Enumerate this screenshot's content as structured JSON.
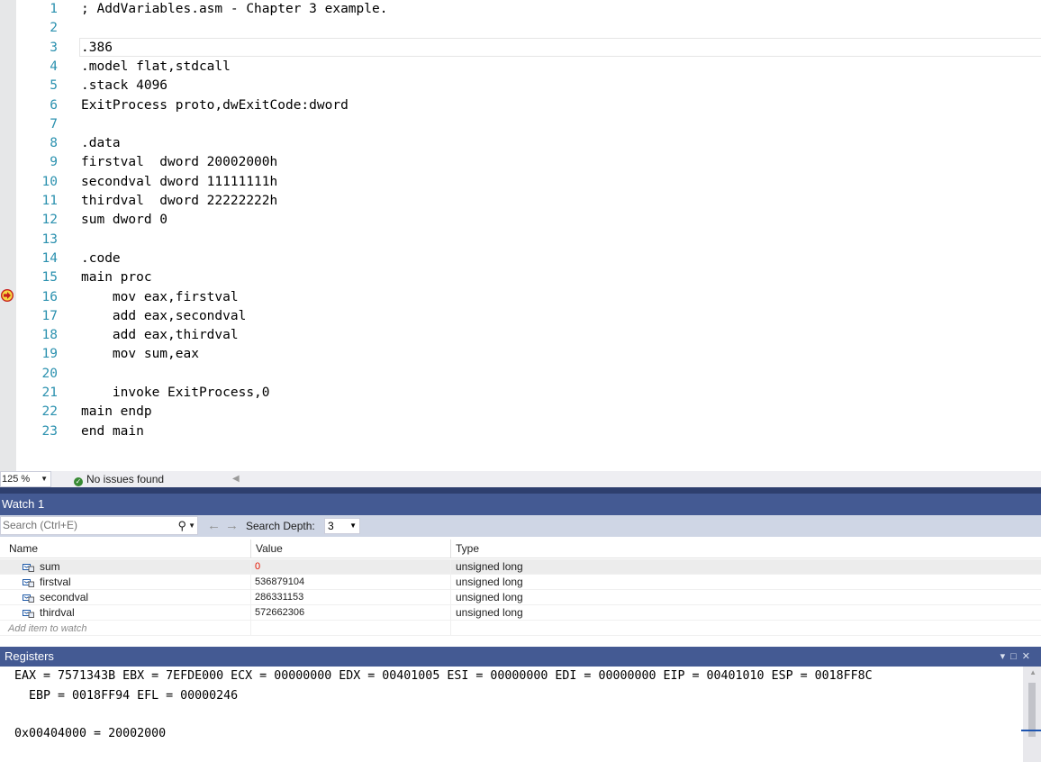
{
  "editor": {
    "line_numbers": [
      "1",
      "2",
      "3",
      "4",
      "5",
      "6",
      "7",
      "8",
      "9",
      "10",
      "11",
      "12",
      "13",
      "14",
      "15",
      "16",
      "17",
      "18",
      "19",
      "20",
      "21",
      "22",
      "23"
    ],
    "code_lines": [
      "; AddVariables.asm - Chapter 3 example.",
      "",
      ".386",
      ".model flat,stdcall",
      ".stack 4096",
      "ExitProcess proto,dwExitCode:dword",
      "",
      ".data",
      "firstval  dword 20002000h",
      "secondval dword 11111111h",
      "thirdval  dword 22222222h",
      "sum dword 0",
      "",
      ".code",
      "main proc",
      "    mov eax,firstval",
      "    add eax,secondval",
      "    add eax,thirdval",
      "    mov sum,eax",
      "",
      "    invoke ExitProcess,0",
      "main endp",
      "end main"
    ],
    "breakpoint_icon": "current-statement-arrow-icon"
  },
  "status_bar": {
    "zoom": "125 %",
    "issues": "No issues found"
  },
  "watch": {
    "title": "Watch 1",
    "search_placeholder": "Search (Ctrl+E)",
    "search_depth_label": "Search Depth:",
    "search_depth_value": "3",
    "columns": [
      "Name",
      "Value",
      "Type"
    ],
    "rows": [
      {
        "name": "sum",
        "value": "0",
        "type": "unsigned long"
      },
      {
        "name": "firstval",
        "value": "536879104",
        "type": "unsigned long"
      },
      {
        "name": "secondval",
        "value": "286331153",
        "type": "unsigned long"
      },
      {
        "name": "thirdval",
        "value": "572662306",
        "type": "unsigned long"
      }
    ],
    "add_item_text": "Add item to watch"
  },
  "registers": {
    "title": "Registers",
    "line1": "EAX = 7571343B EBX = 7EFDE000 ECX = 00000000 EDX = 00401005 ESI = 00000000 EDI = 00000000 EIP = 00401010 ESP = 0018FF8C",
    "line2": "  EBP = 0018FF94 EFL = 00000246",
    "line3": "0x00404000 = 20002000"
  },
  "colors": {
    "title_bar": "#445a93",
    "line_number": "#2b91af",
    "changed_value": "#e51400"
  }
}
